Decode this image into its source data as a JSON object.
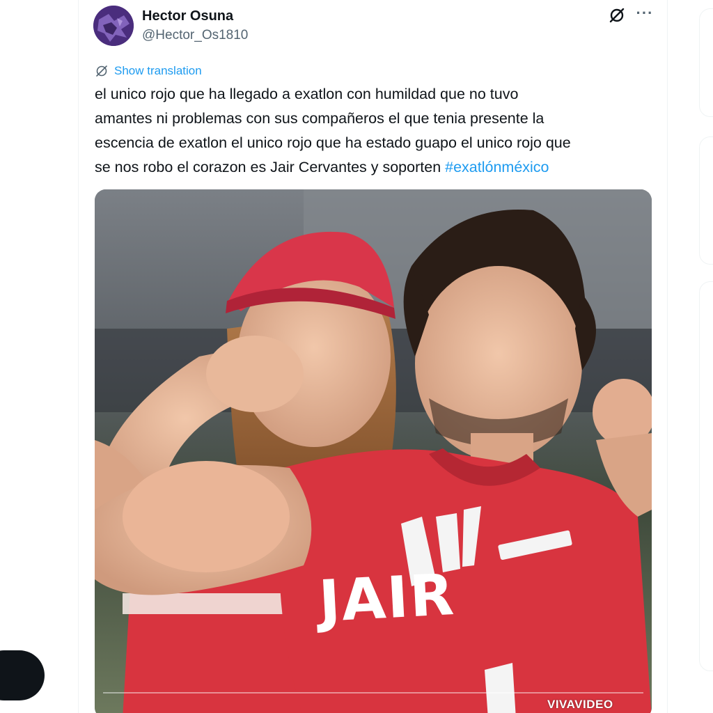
{
  "author": {
    "name": "Hector Osuna",
    "handle": "@Hector_Os1810"
  },
  "icons": {
    "avatar": "avatar-image",
    "grok": "grok-explain-icon",
    "more": "more-horizontal-icon",
    "translate": "translate-icon"
  },
  "actions": {
    "more_label": "···",
    "show_translation": "Show translation"
  },
  "tweet": {
    "lines": [
      "el unico rojo que ha llegado a exatlon con humildad  que no tuvo",
      "amantes ni problemas con sus compañeros el  que tenia presente la",
      "escencia de exatlon el unico rojo que ha estado guapo el unico rojo que",
      "se nos robo el corazon es Jair Cervantes y soporten "
    ],
    "hashtag": "#exatlónméxico"
  },
  "media": {
    "type": "video",
    "jersey_text": "JAIR",
    "watermark": "VIVAVIDEO",
    "progress": 0
  },
  "colors": {
    "text_primary": "#0f1419",
    "text_secondary": "#536471",
    "link": "#1d9bf0",
    "border": "#eff3f4",
    "jersey_red": "#d8343f"
  }
}
